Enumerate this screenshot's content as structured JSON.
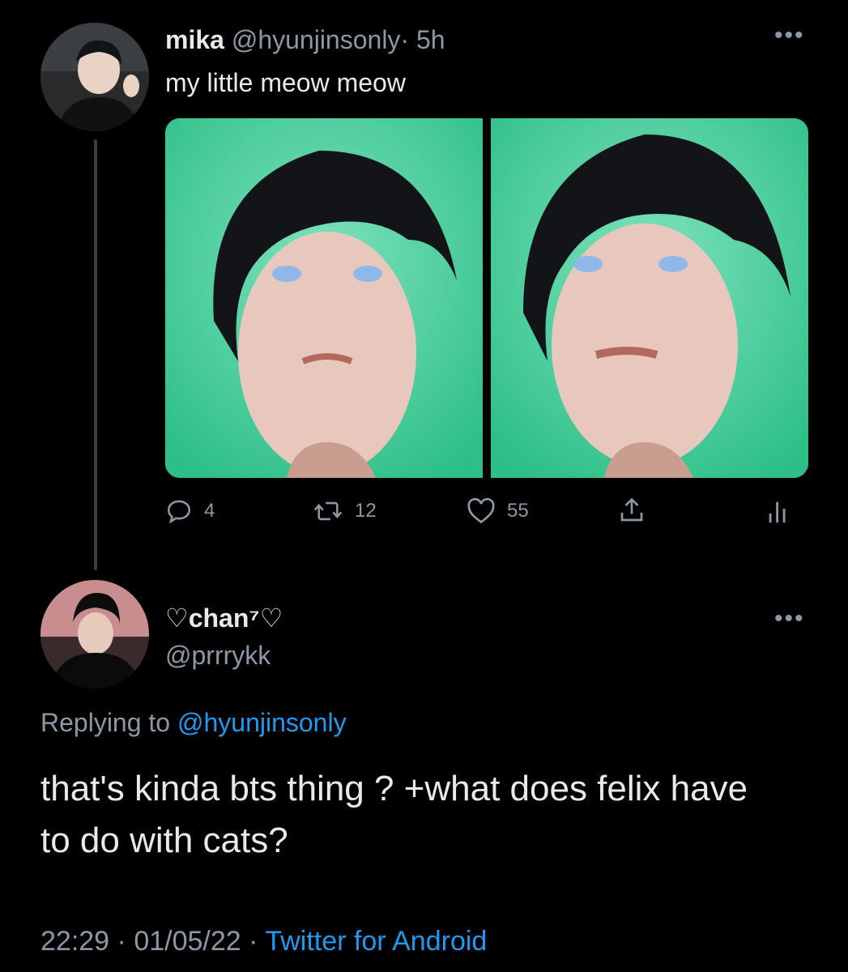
{
  "tweet": {
    "display_name": "mika",
    "handle": "@hyunjinsonly",
    "separator": "·",
    "time": "5h",
    "more_icon": "more-horizontal-icon",
    "text": "my little meow meow",
    "media_count": 2,
    "actions": {
      "replies": "4",
      "retweets": "12",
      "likes": "55"
    }
  },
  "reply": {
    "display_name": "♡chan⁷♡",
    "handle": "@prrrykk",
    "replying_prefix": "Replying to",
    "replying_handle": "@hyunjinsonly",
    "text": "that's kinda bts thing ? +what does felix have to do with cats?",
    "time": "22:29",
    "separator": "·",
    "date": "01/05/22",
    "separator2": "·",
    "source": "Twitter for Android"
  },
  "colors": {
    "background": "#000000",
    "text": "#e7e9ea",
    "muted": "#8b98a5",
    "link": "#1d9bf0",
    "photo_bg": "#3fd0a3"
  }
}
